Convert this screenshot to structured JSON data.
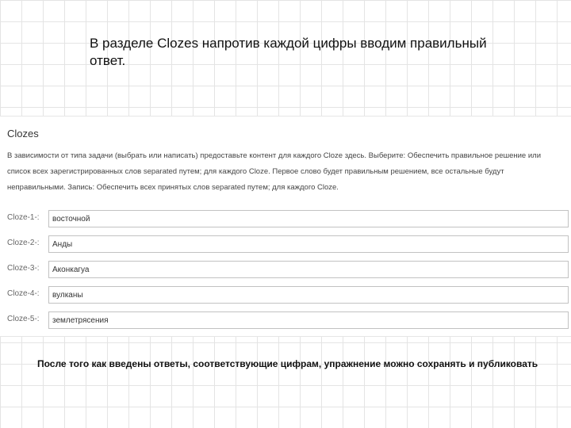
{
  "slide": {
    "title": "В разделе Clozes напротив каждой цифры вводим правильный ответ.",
    "footer": "После того как введены ответы, соответствующие цифрам, упражнение можно сохранять и публиковать"
  },
  "clozes": {
    "heading": "Clozes",
    "instructions": "В зависимости от типа задачи (выбрать или написать) предоставьте контент для каждого Cloze здесь. Выберите: Обеспечить правильное решение или список всех зарегистрированных слов separated путем; для каждого Cloze. Первое слово будет правильным решением, все остальные будут неправильными. Запись: Обеспечить всех принятых слов separated путем; для каждого Cloze.",
    "fields": [
      {
        "label": "Cloze-1-:",
        "value": "восточной"
      },
      {
        "label": "Cloze-2-:",
        "value": "Анды"
      },
      {
        "label": "Cloze-3-:",
        "value": "Аконкагуа"
      },
      {
        "label": "Cloze-4-:",
        "value": "вулканы"
      },
      {
        "label": "Cloze-5-:",
        "value": "землетрясения"
      }
    ]
  }
}
